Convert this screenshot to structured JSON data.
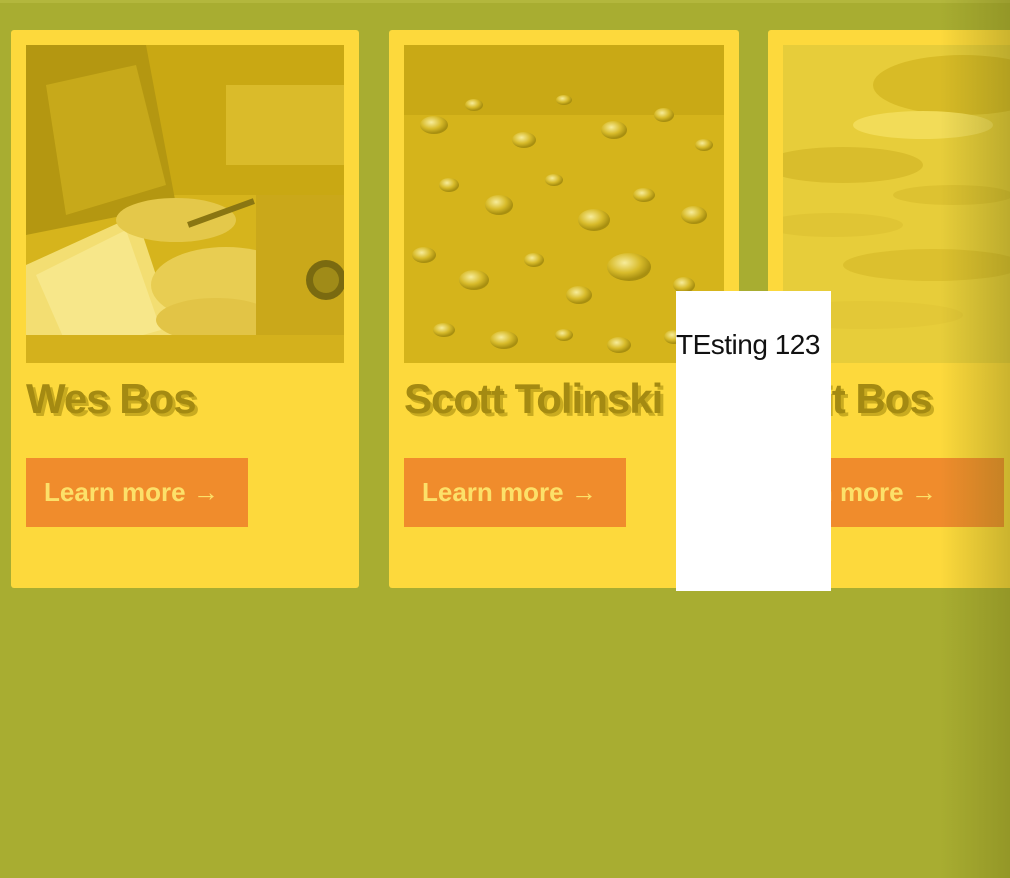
{
  "colors": {
    "page_background": "#a8ad31",
    "card_background": "#fdd93c",
    "card_title": "#a48a12",
    "button_background": "#f08c2c",
    "button_text": "#fce069",
    "popup_background": "#ffffff"
  },
  "cards": [
    {
      "name": "Wes Bos",
      "image": "hands-writing-on-notepad-photo",
      "button_label": "Learn more →"
    },
    {
      "name": "Scott Tolinski",
      "image": "water-droplets-photo",
      "button_label": "Learn more →"
    },
    {
      "name": "Snait Bos",
      "image": "cloudy-sky-photo",
      "button_label": "Learn more →"
    }
  ],
  "popup": {
    "text": "TEsting 123"
  }
}
